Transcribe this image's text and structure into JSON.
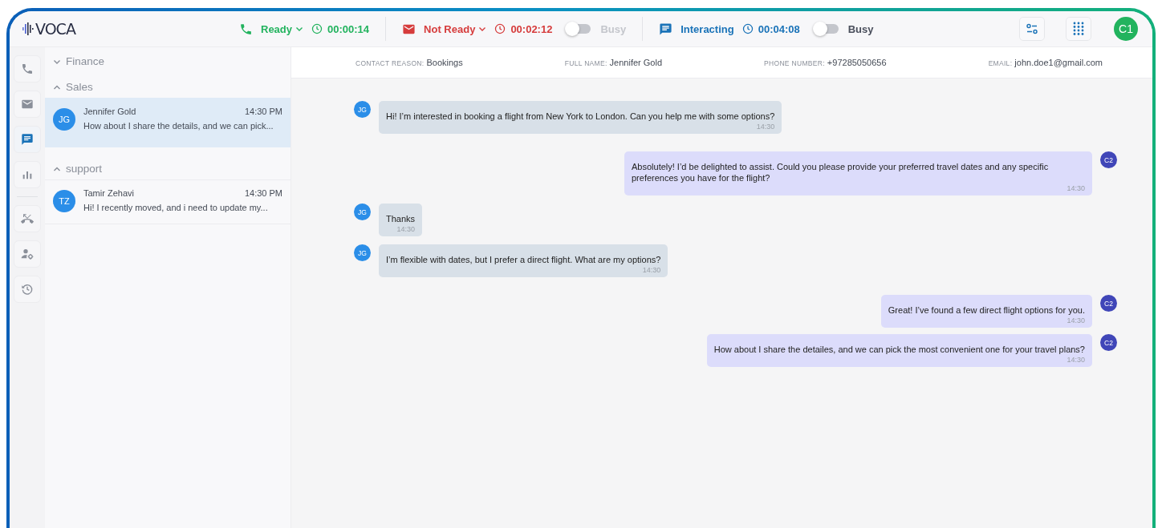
{
  "logo": "VOCA",
  "statuses": [
    {
      "kind": "phone",
      "label": "Ready",
      "dropdown": true,
      "timer": "00:00:14",
      "color": "#22b35e"
    },
    {
      "kind": "mail",
      "label": "Not Ready",
      "dropdown": true,
      "timer": "00:02:12",
      "color": "#d63c3c",
      "toggle": {
        "label": "Busy",
        "on": false,
        "disabled": true
      }
    },
    {
      "kind": "chat",
      "label": "Interacting",
      "dropdown": false,
      "timer": "00:04:08",
      "color": "#1a73b8",
      "toggle": {
        "label": "Busy",
        "on": false,
        "disabled": false
      }
    }
  ],
  "user_avatar": "C1",
  "rail": [
    {
      "kind": "phone",
      "selected": false
    },
    {
      "kind": "mail",
      "selected": false
    },
    {
      "kind": "chat",
      "selected": true
    },
    {
      "kind": "chart",
      "selected": false
    },
    {
      "kind": "divider"
    },
    {
      "kind": "missed",
      "selected": false
    },
    {
      "kind": "user-settings",
      "selected": false
    },
    {
      "kind": "history",
      "selected": false
    }
  ],
  "groups": [
    {
      "name": "Finance",
      "expanded": false
    },
    {
      "name": "Sales",
      "expanded": true,
      "conversations": [
        {
          "initials": "JG",
          "name": "Jennifer Gold",
          "time": "14:30 PM",
          "preview": "How about I share the details, and we can pick...",
          "selected": true
        }
      ]
    },
    {
      "name": "support",
      "expanded": true,
      "conversations": [
        {
          "initials": "TZ",
          "name": "Tamir Zehavi",
          "time": "14:30 PM",
          "preview": "Hi! I recently moved, and i need to update my...",
          "selected": false
        }
      ]
    }
  ],
  "contact": [
    {
      "label": "CONTACT REASON:",
      "value": "Bookings"
    },
    {
      "label": "FULL NAME:",
      "value": "Jennifer Gold"
    },
    {
      "label": "PHONE NUMBER:",
      "value": "+97285050656"
    },
    {
      "label": "EMAIL:",
      "value": "john.doe1@gmail.com"
    }
  ],
  "messages": [
    {
      "kind": "in",
      "avatar": "JG",
      "text": "Hi! I’m interested in booking a flight from New York to London. Can you help me with some options?",
      "time": "14:30"
    },
    {
      "kind": "out",
      "avatar": "C2",
      "text": "Absolutely! I’d be delighted to assist. Could you please provide your preferred travel dates and any specific preferences you have for the flight?",
      "time": "14:30"
    },
    {
      "kind": "in",
      "avatar": "JG",
      "text": "Thanks",
      "time": "14:30"
    },
    {
      "kind": "in",
      "avatar": "JG",
      "text": "I’m flexible with dates, but I prefer a direct flight. What are my options?",
      "time": "14:30"
    },
    {
      "kind": "out",
      "avatar": "C2",
      "text": "Great! I’ve found a few direct flight options for you.",
      "time": "14:30"
    },
    {
      "kind": "out",
      "avatar": "C2",
      "text": "How about I share the detailes, and we can pick the most convenient one for your travel plans?",
      "time": "14:30"
    }
  ]
}
